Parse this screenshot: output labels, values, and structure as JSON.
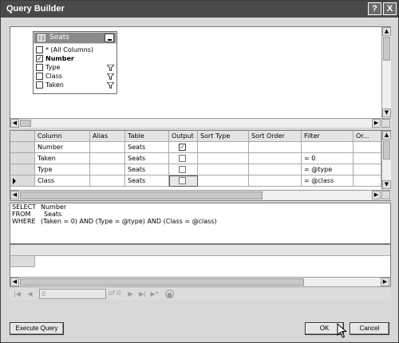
{
  "window": {
    "title": "Query Builder",
    "help_label": "?",
    "close_label": "X"
  },
  "diagram": {
    "table": {
      "name": "Seats",
      "fields": [
        {
          "label": "* (All Columns)",
          "checked": false,
          "bold": false,
          "filtered": false
        },
        {
          "label": "Number",
          "checked": true,
          "bold": true,
          "filtered": false
        },
        {
          "label": "Type",
          "checked": false,
          "bold": false,
          "filtered": true
        },
        {
          "label": "Class",
          "checked": false,
          "bold": false,
          "filtered": true
        },
        {
          "label": "Taken",
          "checked": false,
          "bold": false,
          "filtered": true
        }
      ]
    }
  },
  "grid": {
    "headers": {
      "column": "Column",
      "alias": "Alias",
      "table": "Table",
      "output": "Output",
      "sort_type": "Sort Type",
      "sort_order": "Sort Order",
      "filter": "Filter",
      "or": "Or..."
    },
    "rows": [
      {
        "column": "Number",
        "alias": "",
        "table": "Seats",
        "output": true,
        "sort_type": "",
        "sort_order": "",
        "filter": "",
        "or": ""
      },
      {
        "column": "Taken",
        "alias": "",
        "table": "Seats",
        "output": false,
        "sort_type": "",
        "sort_order": "",
        "filter": "= 0",
        "or": ""
      },
      {
        "column": "Type",
        "alias": "",
        "table": "Seats",
        "output": false,
        "sort_type": "",
        "sort_order": "",
        "filter": "= @type",
        "or": ""
      },
      {
        "column": "Class",
        "alias": "",
        "table": "Seats",
        "output": false,
        "sort_type": "",
        "sort_order": "",
        "filter": "= @class",
        "or": ""
      }
    ]
  },
  "sql": {
    "select_kw": "SELECT",
    "select_val": "Number",
    "from_kw": "FROM",
    "from_val": "Seats",
    "where_kw": "WHERE",
    "where_val": "(Taken = 0) AND (Type = @type) AND (Class = @class)"
  },
  "navigator": {
    "position": "0",
    "of_count": "of 0"
  },
  "buttons": {
    "execute": "Execute Query",
    "ok": "OK",
    "cancel": "Cancel"
  }
}
